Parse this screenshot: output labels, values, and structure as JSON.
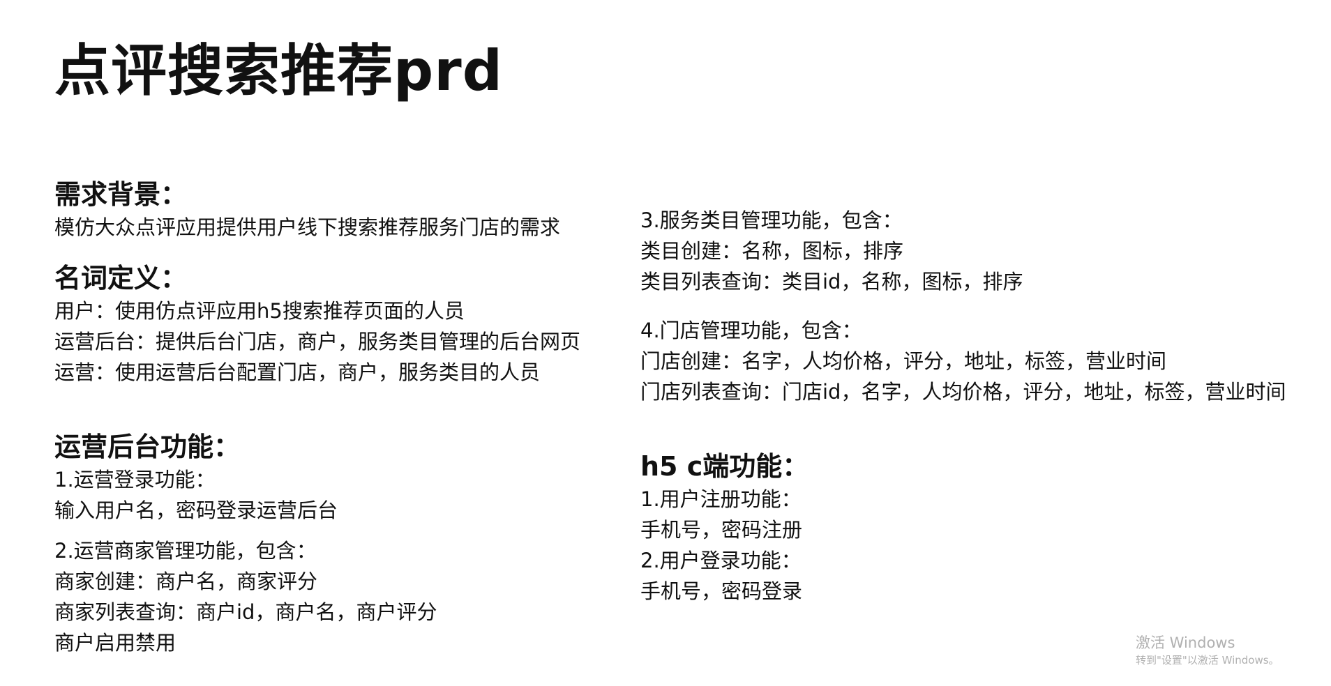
{
  "page": {
    "title": "点评搜索推荐prd"
  },
  "left": {
    "background_heading": "需求背景：",
    "background_text": "模仿大众点评应用提供用户线下搜索推荐服务门店的需求",
    "terms_heading": "名词定义：",
    "terms": [
      "用户：使用仿点评应用h5搜索推荐页面的人员",
      "运营后台：提供后台门店，商户，服务类目管理的后台网页",
      "运营：使用运营后台配置门店，商户，服务类目的人员"
    ],
    "ops_heading": "运营后台功能：",
    "login_title": "1.运营登录功能：",
    "login_text": "输入用户名，密码登录运营后台",
    "merchant_title": "2.运营商家管理功能，包含：",
    "merchant_lines": [
      "商家创建：商户名，商家评分",
      "商家列表查询：商户id，商户名，商户评分",
      "商户启用禁用"
    ]
  },
  "right": {
    "category_title": "3.服务类目管理功能，包含：",
    "category_lines": [
      "类目创建：名称，图标，排序",
      "类目列表查询：类目id，名称，图标，排序"
    ],
    "store_title": "4.门店管理功能，包含：",
    "store_lines": [
      "门店创建：名字，人均价格，评分，地址，标签，营业时间",
      "门店列表查询：门店id，名字，人均价格，评分，地址，标签，营业时间"
    ],
    "h5_heading": "h5 c端功能：",
    "h5_lines": [
      "1.用户注册功能：",
      "手机号，密码注册",
      "2.用户登录功能：",
      "手机号，密码登录"
    ]
  },
  "watermark": {
    "title": "激活 Windows",
    "subtitle": "转到\"设置\"以激活 Windows。"
  }
}
